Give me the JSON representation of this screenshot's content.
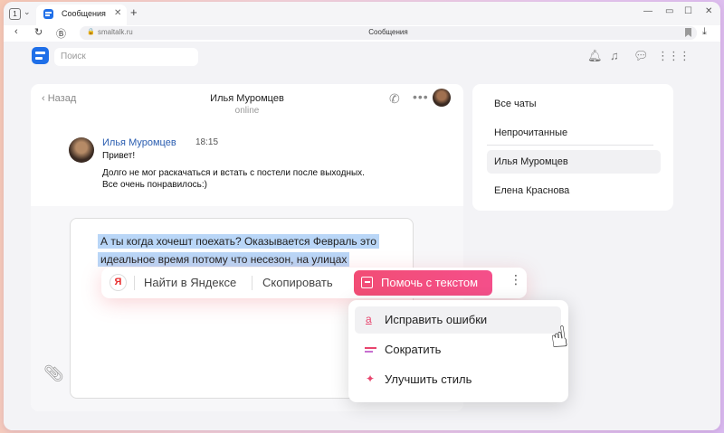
{
  "browser": {
    "tab_counter": "1",
    "tab_title": "Сообщения",
    "address_host": "smaltalk.ru",
    "page_title": "Сообщения"
  },
  "app": {
    "search_placeholder": "Поиск"
  },
  "chat": {
    "back_label": "Назад",
    "contact_name": "Илья Муромцев",
    "contact_status": "online",
    "message": {
      "author": "Илья Муромцев",
      "time": "18:15",
      "lines": [
        "Привет!",
        "Долго не мог раскачаться и встать с постели после выходных.",
        "Все очень понравилось:)"
      ]
    },
    "draft_lines": [
      "А ты когда хочешт поехать? Оказывается Февраль это",
      "идеальное время потому что несезон, на улицах"
    ]
  },
  "sidebar": {
    "items": [
      {
        "label": "Все чаты"
      },
      {
        "label": "Непрочитанные"
      },
      {
        "label": "Илья Муромцев"
      },
      {
        "label": "Елена Краснова"
      }
    ]
  },
  "toolbar": {
    "yandex_logo": "Я",
    "search_label": "Найти в Яндексе",
    "copy_label": "Скопировать",
    "help_label": "Помочь с текстом"
  },
  "dropdown": {
    "items": [
      {
        "label": "Исправить ошибки",
        "icon": "а"
      },
      {
        "label": "Сократить"
      },
      {
        "label": "Улучшить стиль",
        "icon": "✦"
      }
    ]
  },
  "colors": {
    "accent": "#1f6fe8",
    "help_button": "#f24d75",
    "selection": "#b9d6f7"
  }
}
